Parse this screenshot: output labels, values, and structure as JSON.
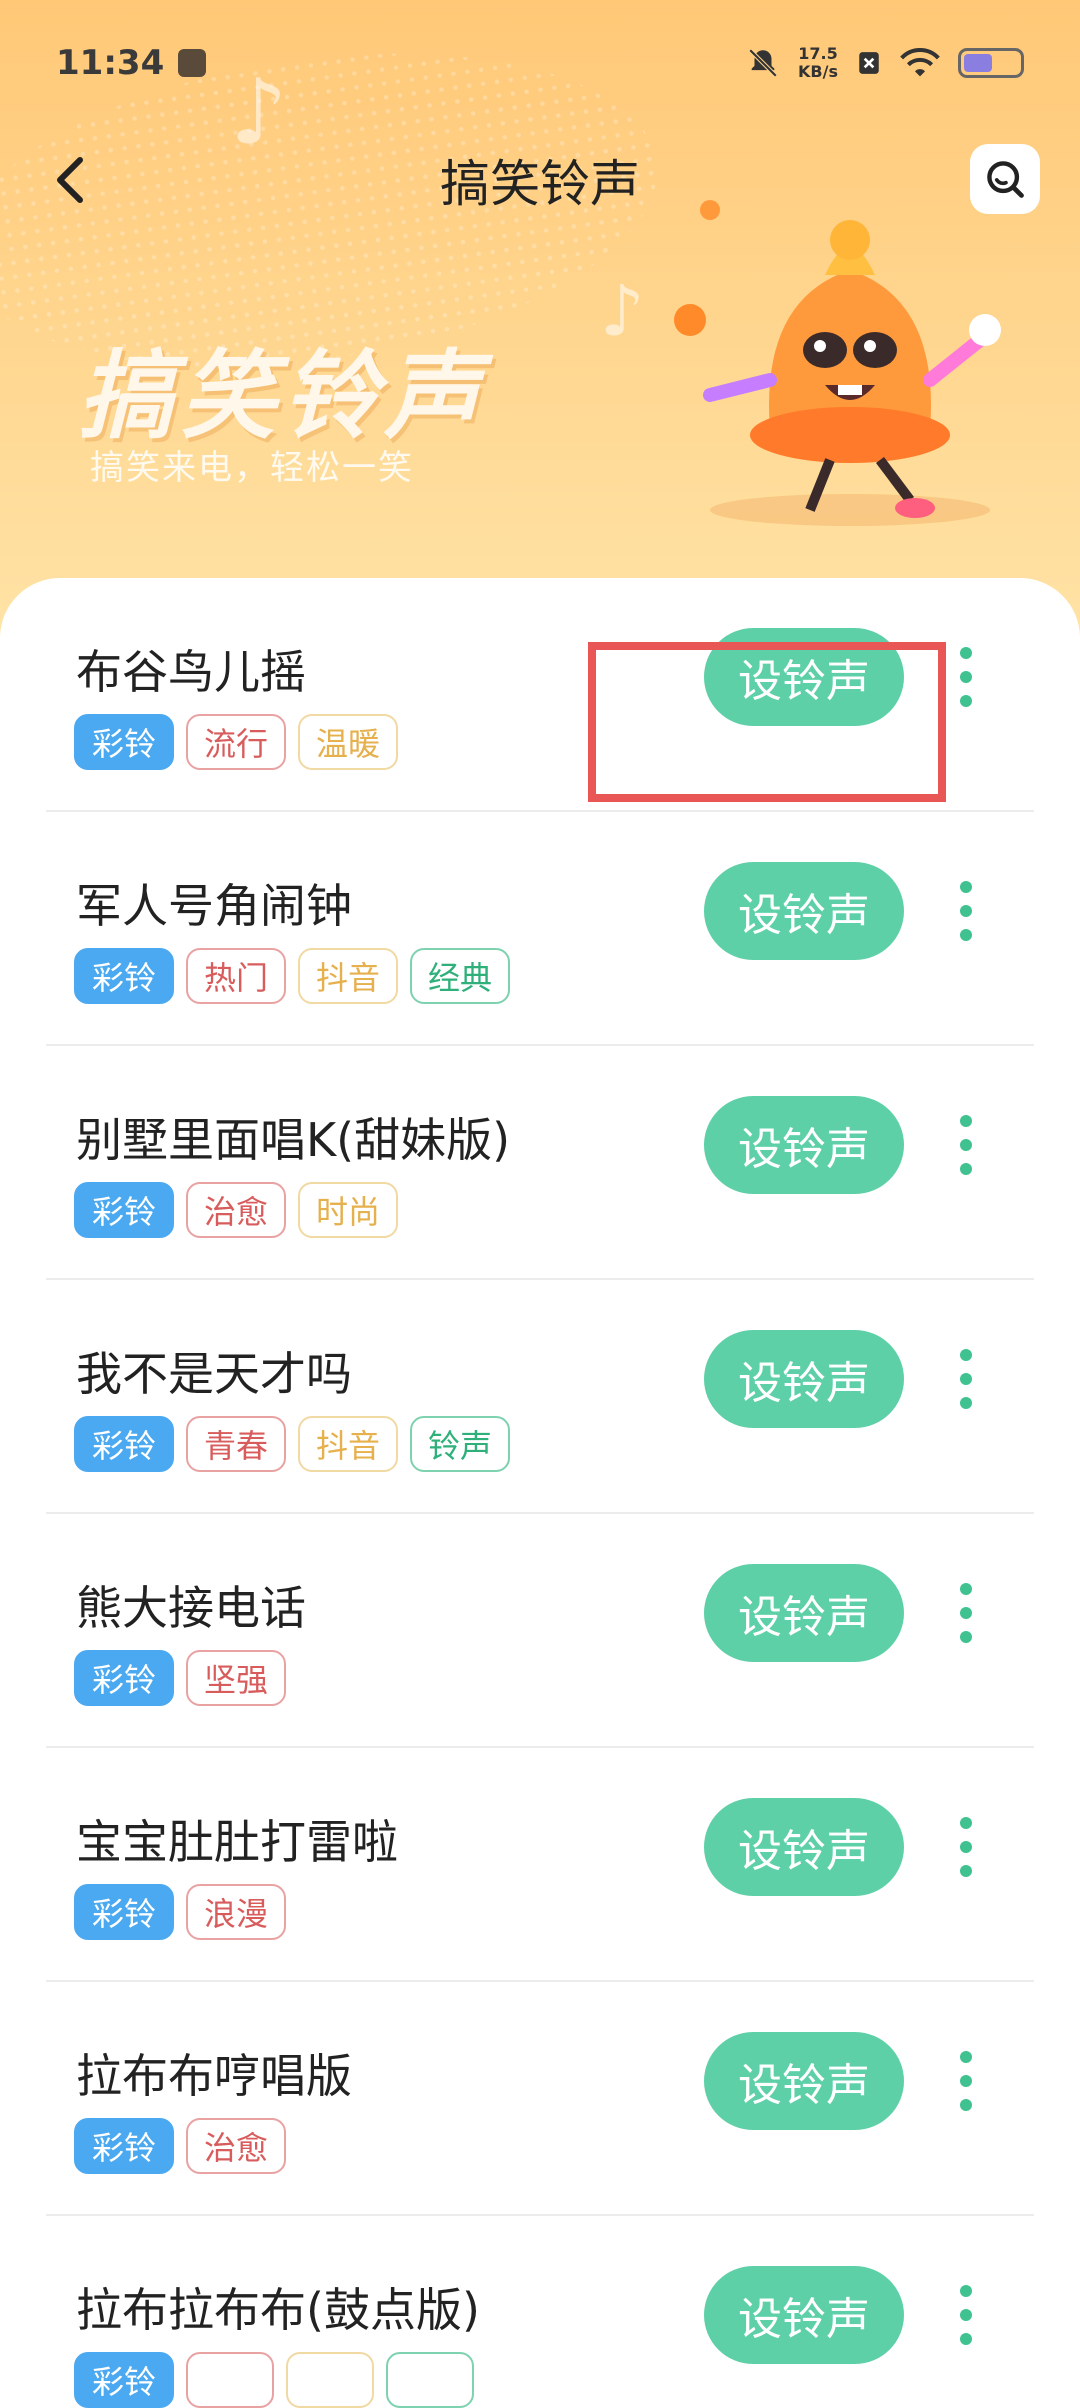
{
  "status_bar": {
    "time": "11:34",
    "speed_value": "17.5",
    "speed_unit": "KB/s"
  },
  "nav": {
    "title": "搞笑铃声",
    "back_icon": "chevron-left-icon",
    "search_icon": "search-icon"
  },
  "banner": {
    "title": "搞笑铃声",
    "subtitle": "搞笑来电，轻松一笑"
  },
  "colors": {
    "accent_green": "#5ed0a7",
    "tag_blue": "#4aa9f0",
    "highlight_red": "#e85656"
  },
  "set_button_label": "设铃声",
  "items": [
    {
      "title": "布谷鸟儿摇",
      "tags": [
        {
          "label": "彩铃",
          "style": "blue"
        },
        {
          "label": "流行",
          "style": "red"
        },
        {
          "label": "温暖",
          "style": "yellow"
        }
      ]
    },
    {
      "title": "军人号角闹钟",
      "tags": [
        {
          "label": "彩铃",
          "style": "blue"
        },
        {
          "label": "热门",
          "style": "red"
        },
        {
          "label": "抖音",
          "style": "yellow"
        },
        {
          "label": "经典",
          "style": "green"
        }
      ]
    },
    {
      "title": "别墅里面唱K(甜妹版)",
      "tags": [
        {
          "label": "彩铃",
          "style": "blue"
        },
        {
          "label": "治愈",
          "style": "red"
        },
        {
          "label": "时尚",
          "style": "yellow"
        }
      ]
    },
    {
      "title": "我不是天才吗",
      "tags": [
        {
          "label": "彩铃",
          "style": "blue"
        },
        {
          "label": "青春",
          "style": "red"
        },
        {
          "label": "抖音",
          "style": "yellow"
        },
        {
          "label": "铃声",
          "style": "green"
        }
      ]
    },
    {
      "title": "熊大接电话",
      "tags": [
        {
          "label": "彩铃",
          "style": "blue"
        },
        {
          "label": "坚强",
          "style": "red"
        }
      ]
    },
    {
      "title": "宝宝肚肚打雷啦",
      "tags": [
        {
          "label": "彩铃",
          "style": "blue"
        },
        {
          "label": "浪漫",
          "style": "red"
        }
      ]
    },
    {
      "title": "拉布布哼唱版",
      "tags": [
        {
          "label": "彩铃",
          "style": "blue"
        },
        {
          "label": "治愈",
          "style": "red"
        }
      ]
    },
    {
      "title": "拉布拉布布(鼓点版)",
      "tags": [
        {
          "label": "彩铃",
          "style": "blue"
        },
        {
          "label": "",
          "style": "red"
        },
        {
          "label": "",
          "style": "yellow"
        },
        {
          "label": "",
          "style": "green"
        }
      ]
    }
  ]
}
